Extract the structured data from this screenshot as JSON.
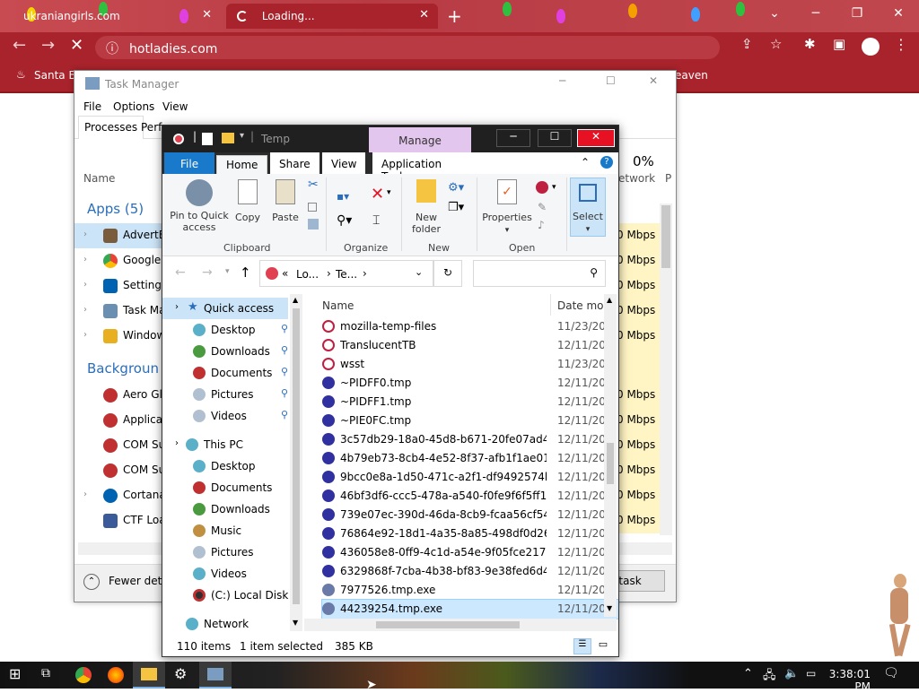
{
  "browser": {
    "tabs": [
      {
        "title": "ukraniangirls.com"
      },
      {
        "title": "Loading..."
      }
    ],
    "url": "hotladies.com",
    "bookmark_left": "Santa Bo",
    "bookmark_right": "eaven",
    "accent": "#a8232b"
  },
  "task_manager": {
    "title": "Task Manager",
    "menu": [
      "File",
      "Options",
      "View"
    ],
    "tabs": [
      "Processes",
      "Perf"
    ],
    "col_name": "Name",
    "col_network_pct": "0%",
    "col_network": "etwork",
    "col_p": "P",
    "apps_header": "Apps (5)",
    "apps": [
      "AdvertB",
      "Google",
      "Settings",
      "Task Ma",
      "Window"
    ],
    "background_header": "Backgroun",
    "background": [
      "Aero Gl",
      "Applicat",
      "COM Su",
      "COM Su",
      "Cortana",
      "CTF Loa"
    ],
    "mbps": [
      "0 Mbps",
      "0 Mbps",
      "0 Mbps",
      "0 Mbps",
      "0 Mbps",
      "0 Mbps",
      "0 Mbps",
      "0 Mbps",
      "0 Mbps",
      "0 Mbps",
      "0 Mbps",
      "0 Mbps"
    ],
    "fewer_details": "Fewer deta",
    "end_task": "d task"
  },
  "explorer": {
    "title": "Temp",
    "manage_tab": "Manage",
    "ribbon_tabs": [
      "File",
      "Home",
      "Share",
      "View",
      "Application Tools"
    ],
    "ribbon": {
      "pin_label": "Pin to Quick access",
      "copy_label": "Copy",
      "paste_label": "Paste",
      "clipboard_group": "Clipboard",
      "organize_group": "Organize",
      "new_folder_label": "New folder",
      "new_group": "New",
      "properties_label": "Properties",
      "open_group": "Open",
      "select_label": "Select"
    },
    "address": {
      "seg1": "Lo...",
      "seg2": "Te..."
    },
    "nav": {
      "quick_access": "Quick access",
      "quick_items": [
        "Desktop",
        "Downloads",
        "Documents",
        "Pictures",
        "Videos"
      ],
      "this_pc": "This PC",
      "pc_items": [
        "Desktop",
        "Documents",
        "Downloads",
        "Music",
        "Pictures",
        "Videos",
        "(C:) Local Disk"
      ],
      "network": "Network"
    },
    "columns": {
      "name": "Name",
      "date": "Date moc"
    },
    "files": [
      {
        "name": "mozilla-temp-files",
        "date": "11/23/202",
        "kind": "folder"
      },
      {
        "name": "TranslucentTB",
        "date": "12/11/202",
        "kind": "folder"
      },
      {
        "name": "wsst",
        "date": "11/23/202",
        "kind": "folder"
      },
      {
        "name": "~PIDFF0.tmp",
        "date": "12/11/202",
        "kind": "file"
      },
      {
        "name": "~PIDFF1.tmp",
        "date": "12/11/202",
        "kind": "file"
      },
      {
        "name": "~PIE0FC.tmp",
        "date": "12/11/202",
        "kind": "file"
      },
      {
        "name": "3c57db29-18a0-45d8-b671-20fe07ad4e37...",
        "date": "12/11/202",
        "kind": "file"
      },
      {
        "name": "4b79eb73-8cb4-4e52-8f37-afb1f1ae0185.t...",
        "date": "12/11/202",
        "kind": "file"
      },
      {
        "name": "9bcc0e8a-1d50-471c-a2f1-df9492574bef.t...",
        "date": "12/11/202",
        "kind": "file"
      },
      {
        "name": "46bf3df6-ccc5-478a-a540-f0fe9f6f5ff1.tmp",
        "date": "12/11/202",
        "kind": "file"
      },
      {
        "name": "739e07ec-390d-46da-8cb9-fcaa56cf543b....",
        "date": "12/11/202",
        "kind": "file"
      },
      {
        "name": "76864e92-18d1-4a35-8a85-498df0d26994....",
        "date": "12/11/202",
        "kind": "file"
      },
      {
        "name": "436058e8-0ff9-4c1d-a54e-9f05fce217ce.t...",
        "date": "12/11/202",
        "kind": "file"
      },
      {
        "name": "6329868f-7cba-4b38-bf83-9e38fed6d434....",
        "date": "12/11/202",
        "kind": "file"
      },
      {
        "name": "7977526.tmp.exe",
        "date": "12/11/202",
        "kind": "exe"
      },
      {
        "name": "44239254.tmp.exe",
        "date": "12/11/202",
        "kind": "exe",
        "selected": true
      }
    ],
    "status": {
      "count": "110 items",
      "selected": "1 item selected",
      "size": "385 KB"
    }
  },
  "taskbar": {
    "time": "3:38:01 PM"
  }
}
